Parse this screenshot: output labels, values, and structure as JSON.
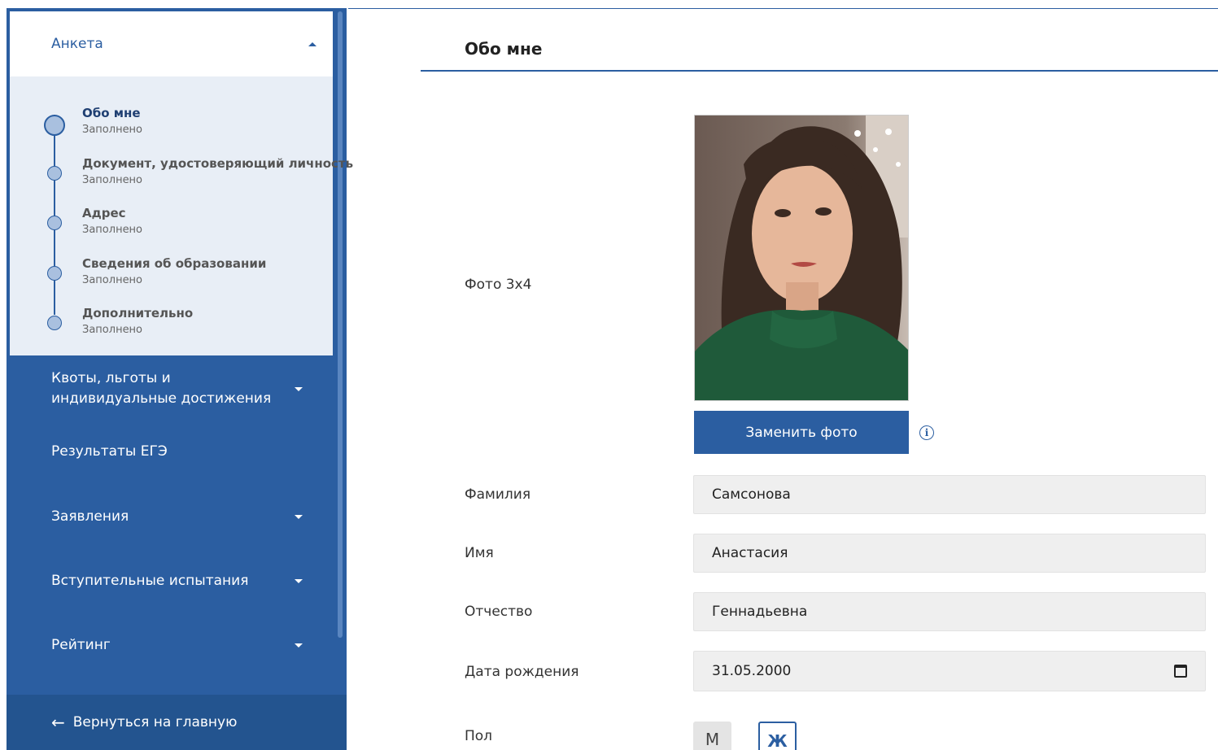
{
  "sidebar": {
    "accordion_title": "Анкета",
    "steps": [
      {
        "title": "Обо мне",
        "status": "Заполнено",
        "active": true
      },
      {
        "title": "Документ, удостоверяющий личность",
        "status": "Заполнено",
        "active": false
      },
      {
        "title": "Адрес",
        "status": "Заполнено",
        "active": false
      },
      {
        "title": "Сведения об образовании",
        "status": "Заполнено",
        "active": false
      },
      {
        "title": "Дополнительно",
        "status": "Заполнено",
        "active": false
      }
    ],
    "nav": [
      {
        "label": "Квоты, льготы и индивидуальные достижения",
        "has_dropdown": true
      },
      {
        "label": "Результаты ЕГЭ",
        "has_dropdown": false
      },
      {
        "label": "Заявления",
        "has_dropdown": true
      },
      {
        "label": "Вступительные испытания",
        "has_dropdown": true
      },
      {
        "label": "Рейтинг",
        "has_dropdown": true
      }
    ],
    "back_label": "Вернуться на главную",
    "back_icon": "arrow-left-icon"
  },
  "main": {
    "title": "Обо мне",
    "photo_label": "Фото 3x4",
    "replace_photo_button": "Заменить фото",
    "info_icon": "info-icon",
    "fields": [
      {
        "label": "Фамилия",
        "value": "Самсонова"
      },
      {
        "label": "Имя",
        "value": "Анастасия"
      },
      {
        "label": "Отчество",
        "value": "Геннадьевна"
      },
      {
        "label": "Дата рождения",
        "value": "31.05.2000",
        "icon": "calendar-icon"
      }
    ],
    "sex_label": "Пол",
    "sex_options": [
      "М",
      "Ж"
    ],
    "sex_selected": "Ж"
  },
  "colors": {
    "brand": "#2b5ea1",
    "sidebar_bg": "#2b5ea1",
    "step_bg": "#e8eef6",
    "field_bg": "#efefef"
  }
}
